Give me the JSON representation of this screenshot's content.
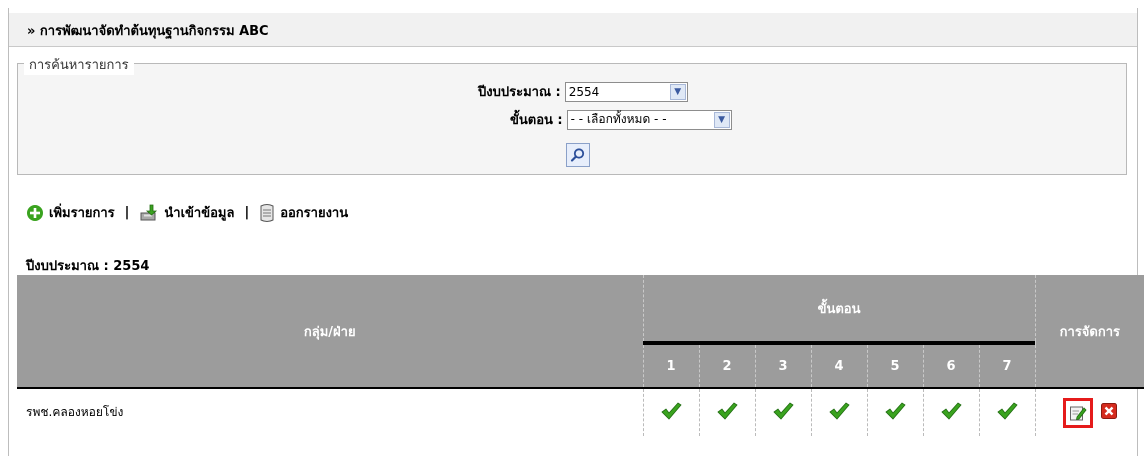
{
  "page": {
    "title": "» การพัฒนาจัดทำต้นทุนฐานกิจกรรม ABC"
  },
  "search": {
    "legend": "การค้นหารายการ",
    "fiscal_year_label": "ปีงบประมาณ :",
    "fiscal_year_value": "2554",
    "step_label": "ขั้นตอน :",
    "step_value": "- - เลือกทั้งหมด - -"
  },
  "toolbar": {
    "add_label": "เพิ่มรายการ",
    "import_label": "นำเข้าข้อมูล",
    "report_label": "ออกรายงาน",
    "separator": "|"
  },
  "year_heading": "ปีงบประมาณ : 2554",
  "table": {
    "col_group": "กลุ่ม/ฝ่าย",
    "col_steps": "ขั้นตอน",
    "col_manage": "การจัดการ",
    "steps": [
      "1",
      "2",
      "3",
      "4",
      "5",
      "6",
      "7"
    ],
    "rows": [
      {
        "name": "รพช.คลองหอยโข่ง",
        "steps_done": [
          true,
          true,
          true,
          true,
          true,
          true,
          true
        ]
      }
    ]
  },
  "icons": {
    "add": "plus-circle-icon",
    "import": "import-icon",
    "report": "report-icon",
    "search": "search-icon",
    "check": "check-icon",
    "edit": "edit-icon",
    "delete": "delete-icon"
  },
  "colors": {
    "header_bg": "#9c9c9c",
    "check_green": "#3aa31f",
    "highlight_red": "#e51b1b",
    "delete_red": "#d52b1e"
  }
}
